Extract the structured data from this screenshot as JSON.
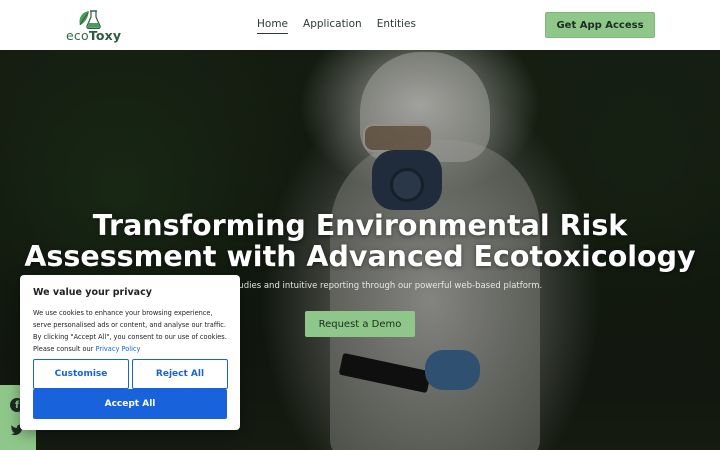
{
  "header": {
    "logo": {
      "prefix": "eco",
      "suffix": "Toxy",
      "icon": "leaf-flask-icon"
    },
    "nav": [
      {
        "label": "Home",
        "active": true
      },
      {
        "label": "Application",
        "active": false
      },
      {
        "label": "Entities",
        "active": false
      }
    ],
    "cta_label": "Get App Access"
  },
  "hero": {
    "title_line1": "Transforming Environmental Risk",
    "title_line2": "Assessment with Advanced Ecotoxicology",
    "subtitle": "y-compliant studies and intuitive reporting through our powerful web-based platform.",
    "button_label": "Request a Demo"
  },
  "social": {
    "facebook": "f",
    "twitter": "twitter-icon"
  },
  "cookie": {
    "title": "We value your privacy",
    "text": "We use cookies to enhance your browsing experience, serve personalised ads or content, and analyse our traffic. By clicking \"Accept All\", you consent to our use of cookies. Please consult our",
    "link_label": "Privacy Policy",
    "customise_label": "Customise",
    "reject_label": "Reject All",
    "accept_label": "Accept All"
  },
  "colors": {
    "brand_green": "#8fc78b",
    "cookie_blue": "#1863dc",
    "logo_green": "#2e6b48"
  }
}
